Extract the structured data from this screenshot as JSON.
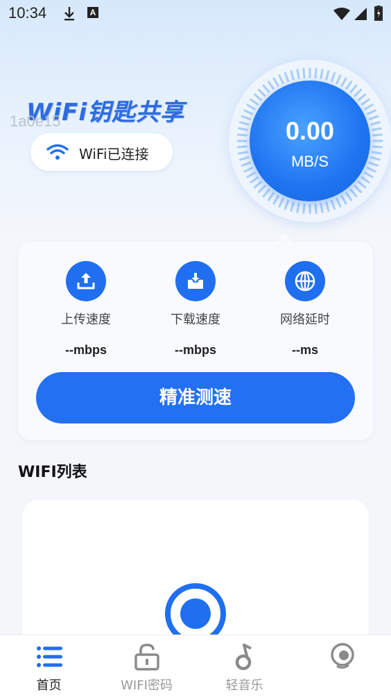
{
  "status_bar": {
    "time": "10:34",
    "a_badge": "A",
    "icons": [
      "download-icon",
      "a-icon",
      "wifi-icon",
      "signal-icon",
      "battery-icon"
    ]
  },
  "header": {
    "brand": "WiFi钥匙共享",
    "watermark": "1a0e15",
    "connection_status": "WiFi已连接"
  },
  "speed_dial": {
    "value": "0.00",
    "unit": "MB/S"
  },
  "speed_card": {
    "stats": [
      {
        "icon": "upload-icon",
        "label": "上传速度",
        "value": "--mbps"
      },
      {
        "icon": "download-tray-icon",
        "label": "下载速度",
        "value": "--mbps"
      },
      {
        "icon": "globe-icon",
        "label": "网络延时",
        "value": "--ms"
      }
    ],
    "test_button": "精准测速"
  },
  "wifi_list": {
    "title": "WIFI列表"
  },
  "bottom_nav": {
    "items": [
      {
        "label": "首页",
        "icon": "list-icon",
        "active": true
      },
      {
        "label": "WIFI密码",
        "icon": "lock-icon",
        "active": false
      },
      {
        "label": "轻音乐",
        "icon": "music-note-icon",
        "active": false
      },
      {
        "label": "",
        "icon": "profile-icon",
        "active": false
      }
    ]
  },
  "colors": {
    "accent": "#2370f2",
    "brand": "#2f6be0",
    "card_bg": "#f8fafd"
  }
}
